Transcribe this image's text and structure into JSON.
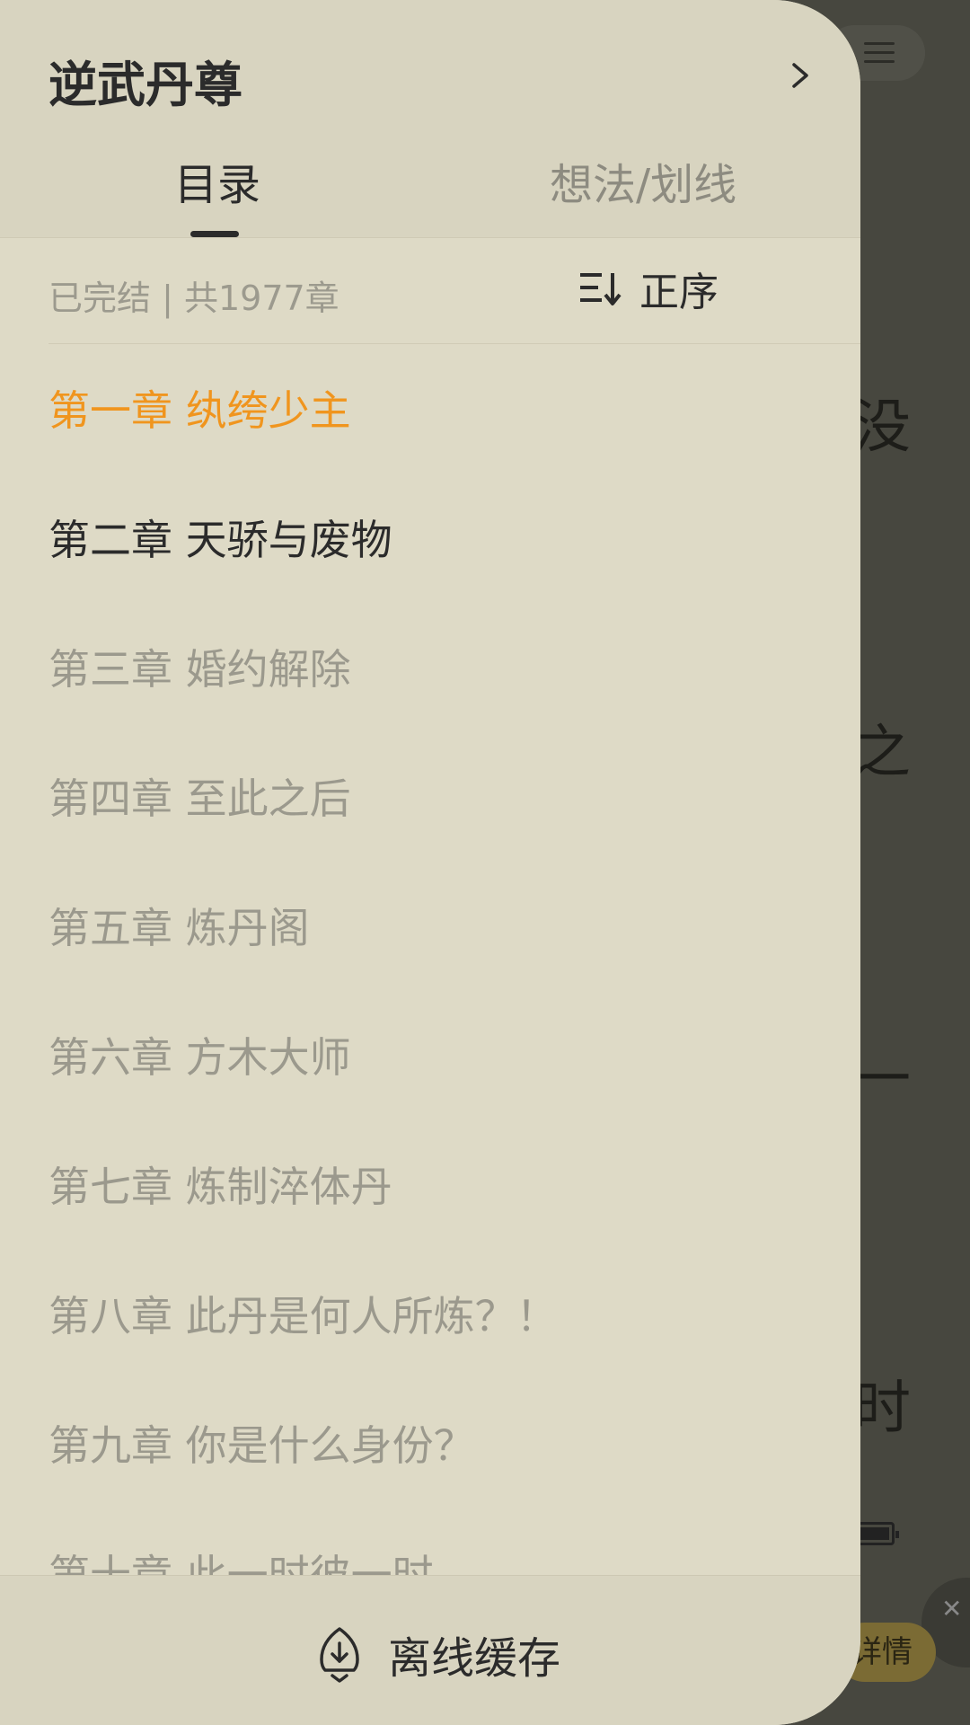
{
  "background": {
    "partial_chars": [
      "没",
      "之",
      "一",
      "时"
    ],
    "detail_button_label": "详情"
  },
  "drawer": {
    "book_title": "逆武丹尊",
    "tabs": [
      {
        "label": "目录",
        "active": true
      },
      {
        "label": "想法/划线",
        "active": false
      }
    ],
    "status_text": "已完结 | 共1977章",
    "sort_label": "正序",
    "chapters": [
      {
        "title": "第一章 纨绔少主",
        "state": "current"
      },
      {
        "title": "第二章 天骄与废物",
        "state": "read"
      },
      {
        "title": "第三章 婚约解除",
        "state": "unread"
      },
      {
        "title": "第四章 至此之后",
        "state": "unread"
      },
      {
        "title": "第五章 炼丹阁",
        "state": "unread"
      },
      {
        "title": "第六章 方木大师",
        "state": "unread"
      },
      {
        "title": "第七章 炼制淬体丹",
        "state": "unread"
      },
      {
        "title": "第八章 此丹是何人所炼？！",
        "state": "unread"
      },
      {
        "title": "第九章 你是什么身份？",
        "state": "unread"
      },
      {
        "title": "第十章 此一时彼一时",
        "state": "unread"
      }
    ],
    "footer_label": "离线缓存"
  },
  "colors": {
    "accent_current_chapter": "#f0951e",
    "drawer_background": "#dedac6",
    "text_primary": "#2b2b2b",
    "text_secondary": "#9b998d"
  },
  "icons": {
    "header_next": "chevron-right-icon",
    "sort": "sort-order-icon",
    "offline": "download-cache-icon",
    "background_menu": "menu-icon",
    "background_close": "close-icon",
    "background_battery": "battery-icon"
  }
}
